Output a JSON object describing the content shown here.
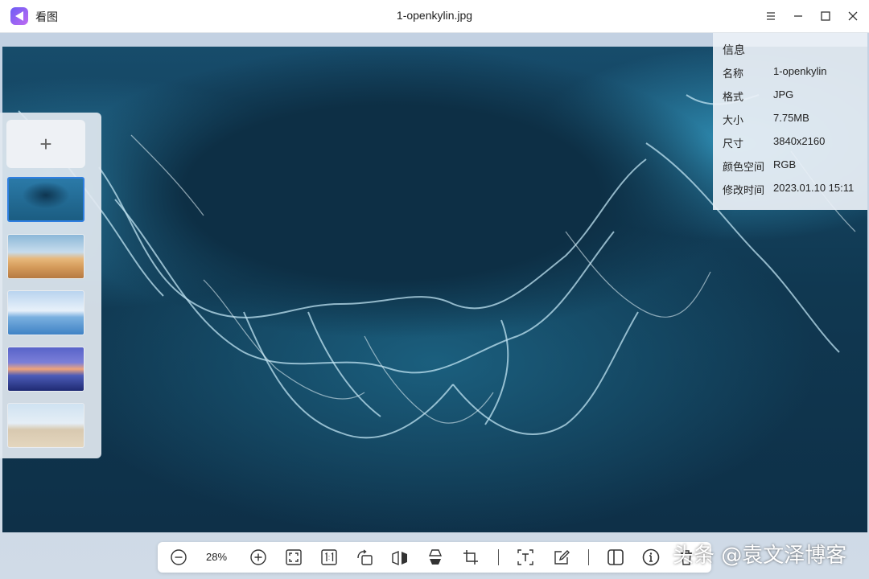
{
  "window": {
    "app_name": "看图",
    "title": "1-openkylin.jpg",
    "buttons": {
      "menu": "menu",
      "minimize": "minimize",
      "maximize": "maximize",
      "close": "close"
    }
  },
  "thumbnails": {
    "add_label": "+",
    "items": [
      {
        "name": "ocean-aerial",
        "selected": true
      },
      {
        "name": "desert-dunes",
        "selected": false
      },
      {
        "name": "blue-waves",
        "selected": false
      },
      {
        "name": "purple-mountains",
        "selected": false
      },
      {
        "name": "building",
        "selected": false
      }
    ]
  },
  "info": {
    "heading": "信息",
    "rows": [
      {
        "key": "名称",
        "value": "1-openkylin"
      },
      {
        "key": "格式",
        "value": "JPG"
      },
      {
        "key": "大小",
        "value": "7.75MB"
      },
      {
        "key": "尺寸",
        "value": "3840x2160"
      },
      {
        "key": "颜色空间",
        "value": "RGB"
      },
      {
        "key": "修改时间",
        "value": "2023.01.10 15:11"
      }
    ]
  },
  "toolbar": {
    "zoom_level": "28%",
    "tools": [
      "zoom-out-icon",
      "zoom-in-icon",
      "fit-window-icon",
      "actual-size-icon",
      "rotate-icon",
      "flip-horizontal-icon",
      "flip-vertical-icon",
      "crop-icon",
      "ocr-text-icon",
      "edit-icon",
      "sidebar-toggle-icon",
      "info-icon",
      "delete-icon"
    ]
  },
  "watermark": "头条 @袁文泽博客",
  "colors": {
    "accent": "#2f7fe0",
    "toolbar_bg": "#ffffff"
  }
}
